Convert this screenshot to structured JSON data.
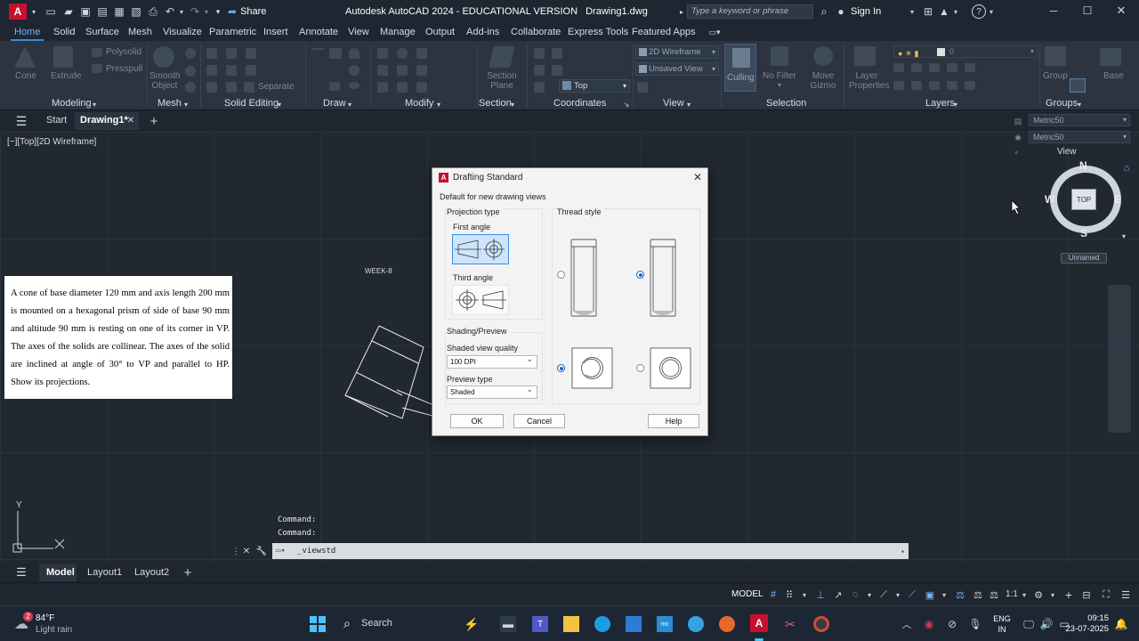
{
  "titlebar": {
    "app_title": "Autodesk AutoCAD 2024 - EDUCATIONAL VERSION",
    "file_name": "Drawing1.dwg",
    "share_label": "Share",
    "search_placeholder": "Type a keyword or phrase",
    "sign_in": "Sign In"
  },
  "ribbon_tabs": [
    "Home",
    "Solid",
    "Surface",
    "Mesh",
    "Visualize",
    "Parametric",
    "Insert",
    "Annotate",
    "View",
    "Manage",
    "Output",
    "Add-ins",
    "Collaborate",
    "Express Tools",
    "Featured Apps"
  ],
  "ribbon": {
    "panels": [
      "Modeling",
      "Mesh",
      "Solid Editing",
      "Draw",
      "Modify",
      "Section",
      "Coordinates",
      "View",
      "Selection",
      "Layers",
      "Groups"
    ],
    "tools": {
      "cone": "Cone",
      "extrude": "Extrude",
      "polysolid": "Polysolid",
      "presspull": "Presspull",
      "smooth_object": "Smooth Object",
      "separate": "Separate",
      "section_plane": "Section Plane",
      "visual_style": "2D Wireframe",
      "unsaved_view": "Unsaved View",
      "top_view": "Top",
      "culling": "Culling",
      "no_filter": "No Filter",
      "move_gizmo": "Move Gizmo",
      "layer_properties": "Layer Properties",
      "group": "Group",
      "base": "Base",
      "layer_value": "0"
    }
  },
  "file_tabs": {
    "start": "Start",
    "drawing": "Drawing1*"
  },
  "viewport": {
    "view_label": "[−][Top][2D Wireframe]",
    "week_label": "WEEK-8",
    "problem_text": "A cone of base diameter 120 mm and axis length 200 mm is mounted on a hexagonal prism of side of base 90 mm and altitude 90 mm is resting on one of its corner in VP. The axes of the solids are collinear. The axes of the solid are inclined at angle of 30° to VP and parallel to HP. Show its projections.",
    "ucs_y": "Y",
    "viewcube": {
      "n": "N",
      "s": "S",
      "e": "E",
      "w": "W",
      "face": "TOP",
      "ucs": "Unnamed"
    },
    "right_panel": {
      "style1": "Metric50",
      "style2": "Metric50",
      "view_label": "View"
    }
  },
  "command": {
    "history": [
      "Command:",
      "Command:"
    ],
    "input_value": "_viewstd"
  },
  "dialog": {
    "title": "Drafting Standard",
    "subtitle": "Default for new drawing views",
    "projection_type": "Projection type",
    "first_angle": "First angle",
    "third_angle": "Third angle",
    "thread_style": "Thread style",
    "shading_preview": "Shading/Preview",
    "shaded_view_quality": "Shaded view quality",
    "quality_value": "100 DPI",
    "preview_type": "Preview type",
    "preview_value": "Shaded",
    "ok": "OK",
    "cancel": "Cancel",
    "help": "Help",
    "selected_projection": "First angle"
  },
  "layout_tabs": [
    "Model",
    "Layout1",
    "Layout2"
  ],
  "statusbar": {
    "model": "MODEL",
    "scale": "1:1"
  },
  "taskbar": {
    "weather_temp": "84°F",
    "weather_desc": "Light rain",
    "notification_count": "2",
    "search": "Search",
    "lang1": "ENG",
    "lang2": "IN",
    "time": "09:15",
    "date": "23-07-2025"
  },
  "colors": {
    "accent": "#3b8ad8",
    "dialog_bg": "#f3f3f3",
    "canvas": "#212830"
  }
}
